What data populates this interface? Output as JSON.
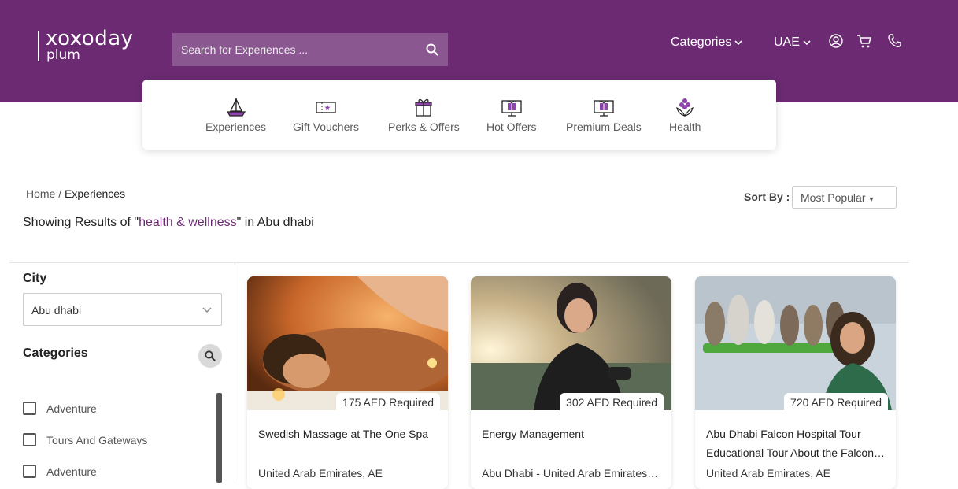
{
  "brand": {
    "line1": "xoxoday",
    "line2": "plum",
    "color": "#6b2a72"
  },
  "search": {
    "placeholder": "Search for Experiences ..."
  },
  "nav": {
    "categories": "Categories",
    "country": "UAE"
  },
  "categories": [
    {
      "label": "Experiences",
      "icon": "sailboat-icon"
    },
    {
      "label": "Gift Vouchers",
      "icon": "voucher-icon"
    },
    {
      "label": "Perks & Offers",
      "icon": "gift-icon"
    },
    {
      "label": "Hot Offers",
      "icon": "gift-screen-icon"
    },
    {
      "label": "Premium Deals",
      "icon": "gift-screen-icon"
    },
    {
      "label": "Health",
      "icon": "lotus-icon"
    }
  ],
  "breadcrumb": {
    "home": "Home",
    "sep": " / ",
    "current": "Experiences"
  },
  "results": {
    "prefix": "Showing Results of \"",
    "query": "health & wellness",
    "suffix": "\" in Abu dhabi"
  },
  "sort": {
    "label": "Sort By :",
    "value": "Most Popular"
  },
  "filters": {
    "city_label": "City",
    "city_value": "Abu dhabi",
    "categories_label": "Categories",
    "items": [
      "Adventure",
      "Tours And Gateways",
      "Adventure"
    ]
  },
  "products": [
    {
      "price": "175 AED Required",
      "title": "Swedish Massage at The One Spa",
      "location": "United Arab Emirates, AE"
    },
    {
      "price": "302 AED Required",
      "title": "Energy Management",
      "location": "Abu Dhabi - United Arab Emirates, AE"
    },
    {
      "price": "720 AED Required",
      "title": "Abu Dhabi Falcon Hospital Tour Educational Tour About the Falcon…",
      "location": "United Arab Emirates, AE"
    }
  ]
}
